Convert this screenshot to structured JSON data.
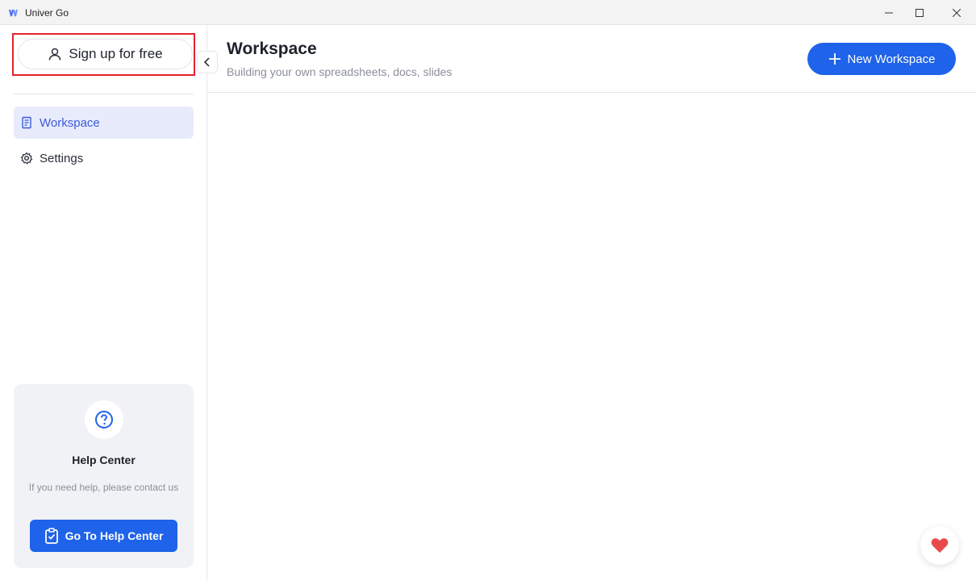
{
  "window": {
    "title": "Univer Go",
    "logo_icon": "univer-logo-icon"
  },
  "sidebar": {
    "signup_label": "Sign up for free",
    "items": [
      {
        "label": "Workspace",
        "icon": "workspace-icon",
        "active": true
      },
      {
        "label": "Settings",
        "icon": "gear-icon",
        "active": false
      }
    ],
    "help": {
      "title": "Help Center",
      "description": "If you need help, please contact us",
      "button_label": "Go To Help Center"
    }
  },
  "main": {
    "title": "Workspace",
    "subtitle": "Building your own spreadsheets, docs, slides",
    "new_button_label": "New Workspace"
  },
  "colors": {
    "accent": "#1e63e9",
    "active_nav_bg": "#e8ebfb",
    "highlight": "#e5222d",
    "heart": "#e84a4a"
  }
}
